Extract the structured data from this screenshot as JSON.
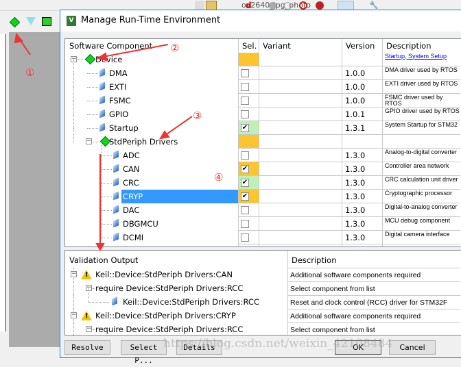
{
  "toolbar": {
    "project_name": "ov2640_jpg_photo"
  },
  "dialog": {
    "title": "Manage Run-Time Environment",
    "app_icon_letter": "V",
    "components": {
      "headers": {
        "component": "Software Component",
        "sel": "Sel.",
        "variant": "Variant",
        "version": "Version",
        "description": "Description"
      },
      "rows": [
        {
          "name": "Device",
          "level": 0,
          "type": "group",
          "sel": "none",
          "sel_color": "#fcc42d",
          "version": "",
          "description": "Startup, System Setup",
          "link": true
        },
        {
          "name": "DMA",
          "level": 1,
          "type": "leaf",
          "sel": "unchecked",
          "version": "1.0.0",
          "description": "DMA driver used by RTOS"
        },
        {
          "name": "EXTI",
          "level": 1,
          "type": "leaf",
          "sel": "unchecked",
          "version": "1.0.0",
          "description": "EXTI driver used by RTOS"
        },
        {
          "name": "FSMC",
          "level": 1,
          "type": "leaf",
          "sel": "unchecked",
          "version": "1.0.0",
          "description": "FSMC driver used by RTOS"
        },
        {
          "name": "GPIO",
          "level": 1,
          "type": "leaf",
          "sel": "unchecked",
          "version": "1.0.1",
          "description": "GPIO driver used by RTOS"
        },
        {
          "name": "Startup",
          "level": 1,
          "type": "leaf",
          "sel": "checked",
          "sel_color": "#c0f0b8",
          "version": "1.3.1",
          "description": "System Startup for STM32"
        },
        {
          "name": "StdPeriph Drivers",
          "level": 1,
          "type": "group",
          "sel": "none",
          "sel_color": "#fcc42d",
          "version": "",
          "description": ""
        },
        {
          "name": "ADC",
          "level": 2,
          "type": "leaf",
          "sel": "unchecked",
          "version": "1.3.0",
          "description": "Analog-to-digital converter"
        },
        {
          "name": "CAN",
          "level": 2,
          "type": "leaf",
          "sel": "checked",
          "sel_color": "#fcc42d",
          "version": "1.3.0",
          "description": "Controller area network"
        },
        {
          "name": "CRC",
          "level": 2,
          "type": "leaf",
          "sel": "checked",
          "sel_color": "#c0f0b8",
          "version": "1.3.0",
          "description": "CRC calculation unit driver"
        },
        {
          "name": "CRYP",
          "level": 2,
          "type": "leaf",
          "sel": "checked",
          "sel_color": "#fcc42d",
          "selected": true,
          "version": "1.3.0",
          "description": "Cryptographic processor"
        },
        {
          "name": "DAC",
          "level": 2,
          "type": "leaf",
          "sel": "unchecked",
          "version": "1.3.0",
          "description": "Digital-to-analog converter"
        },
        {
          "name": "DBGMCU",
          "level": 2,
          "type": "leaf",
          "sel": "unchecked",
          "version": "1.3.0",
          "description": "MCU debug component"
        },
        {
          "name": "DCMI",
          "level": 2,
          "type": "leaf",
          "sel": "unchecked",
          "version": "1.3.0",
          "description": "Digital camera interface"
        }
      ]
    },
    "validation": {
      "headers": {
        "output": "Validation Output",
        "description": "Description"
      },
      "rows": [
        {
          "text": "Keil::Device:StdPeriph Drivers:CAN",
          "level": 0,
          "icon": "warning",
          "description": "Additional software components required"
        },
        {
          "text": "require Device:StdPeriph Drivers:RCC",
          "level": 1,
          "icon": "none",
          "description": "Select component from list"
        },
        {
          "text": "Keil::Device:StdPeriph Drivers:RCC",
          "level": 2,
          "icon": "component",
          "description": "Reset and clock control (RCC) driver for STM32F"
        },
        {
          "text": "Keil::Device:StdPeriph Drivers:CRYP",
          "level": 0,
          "icon": "warning",
          "description": "Additional software components required"
        },
        {
          "text": "require Device:StdPeriph Drivers:RCC",
          "level": 1,
          "icon": "none",
          "description": "Select component from list"
        }
      ]
    },
    "buttons": {
      "resolve": "Resolve",
      "select_packs": "Select P...",
      "details": "Details",
      "ok": "OK",
      "cancel": "Cancel"
    }
  },
  "annotations": [
    "①",
    "②",
    "③",
    "④"
  ],
  "watermark": "https://blog.csdn.net/weixin_42108484"
}
